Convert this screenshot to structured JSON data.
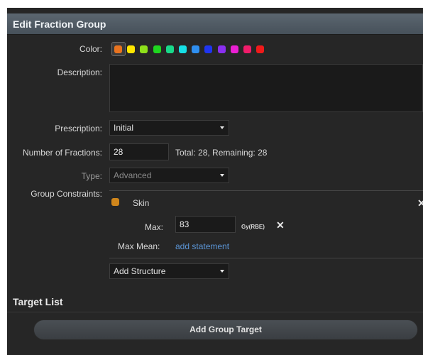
{
  "header": {
    "title": "Edit Fraction Group"
  },
  "color": {
    "label": "Color:",
    "swatches": [
      "#e8731f",
      "#ffe600",
      "#8ee01a",
      "#1fd61f",
      "#19d98a",
      "#16e0e6",
      "#2f8ff0",
      "#1f35f0",
      "#8a2ff0",
      "#ea1fd3",
      "#f01c6a",
      "#f01a1a"
    ],
    "selected_index": 0
  },
  "description": {
    "label": "Description:",
    "value": ""
  },
  "prescription": {
    "label": "Prescription:",
    "value": "Initial"
  },
  "fractions": {
    "label": "Number of Fractions:",
    "value": "28",
    "summary": "Total: 28, Remaining: 28"
  },
  "type": {
    "label": "Type:",
    "value": "Advanced"
  },
  "group_constraints": {
    "label": "Group Constraints:",
    "structure": {
      "name": "Skin",
      "color": "#d0861b"
    },
    "max": {
      "label": "Max:",
      "value": "83",
      "unit": "Gy(RBE)"
    },
    "max_mean": {
      "label": "Max Mean:",
      "link": "add statement"
    },
    "add_structure": "Add Structure"
  },
  "target_list": {
    "title": "Target List",
    "add_button": "Add Group Target"
  }
}
